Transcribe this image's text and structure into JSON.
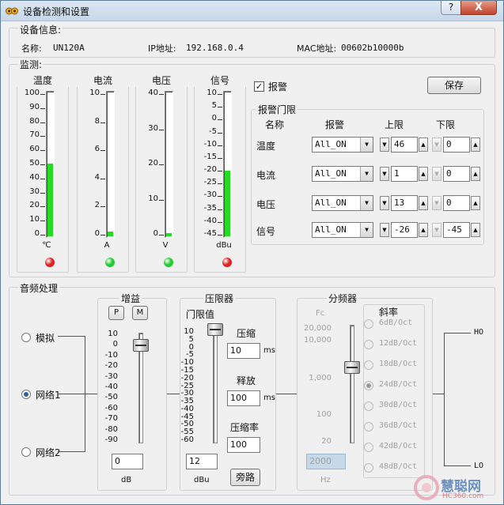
{
  "window": {
    "title": "设备检测和设置",
    "help": "?",
    "close": "X"
  },
  "device_info": {
    "header": "设备信息:",
    "name_label": "名称:",
    "name_value": "UN120A",
    "ip_label": "IP地址:",
    "ip_value": "192.168.0.4",
    "mac_label": "MAC地址:",
    "mac_value": "00602b10000b"
  },
  "monitor": {
    "header": "监测:",
    "meters": [
      {
        "title": "温度",
        "unit": "℃",
        "ticks": [
          "100",
          "90",
          "80",
          "70",
          "60",
          "50",
          "40",
          "30",
          "20",
          "10",
          "0"
        ],
        "level": 0.5,
        "led": "#e02020"
      },
      {
        "title": "电流",
        "unit": "A",
        "ticks": [
          "10",
          "8",
          "6",
          "4",
          "2",
          "0"
        ],
        "level": 0.03,
        "led": "#22cc33"
      },
      {
        "title": "电压",
        "unit": "V",
        "ticks": [
          "40",
          "30",
          "20",
          "10",
          "0"
        ],
        "level": 0.02,
        "led": "#22cc33"
      },
      {
        "title": "信号",
        "unit": "dBu",
        "ticks": [
          "10",
          "5",
          "0",
          "-5",
          "-10",
          "-15",
          "-20",
          "-25",
          "-30",
          "-35",
          "-40",
          "-45"
        ],
        "level": 0.45,
        "led": "#e02020"
      }
    ],
    "alarm_checkbox": "报警",
    "alarm_checked": "✓",
    "save_button": "保存",
    "threshold": {
      "header": "报警门限",
      "col_name": "名称",
      "col_alarm": "报警",
      "col_upper": "上限",
      "col_lower": "下限",
      "rows": [
        {
          "name": "温度",
          "alarm": "All_ON",
          "upper": "46",
          "lower": "0"
        },
        {
          "name": "电流",
          "alarm": "All_ON",
          "upper": "1",
          "lower": "0"
        },
        {
          "name": "电压",
          "alarm": "All_ON",
          "upper": "13",
          "lower": "0"
        },
        {
          "name": "信号",
          "alarm": "All_ON",
          "upper": "-26",
          "lower": "-45"
        }
      ]
    }
  },
  "audio": {
    "header": "音频处理",
    "sources": [
      {
        "label": "模拟",
        "selected": false
      },
      {
        "label": "网络1",
        "selected": true
      },
      {
        "label": "网络2",
        "selected": false
      }
    ],
    "gain": {
      "title": "增益",
      "p_button": "P",
      "m_button": "M",
      "ticks": [
        "10",
        "0",
        "-10",
        "-20",
        "-30",
        "-40",
        "-50",
        "-60",
        "-70",
        "-80",
        "-90"
      ],
      "value": "0",
      "unit": "dB",
      "slider_value_db": 0
    },
    "limiter": {
      "title": "压限器",
      "threshold_label": "门限值",
      "ticks": [
        "10",
        "5",
        "0",
        "-5",
        "-10",
        "-15",
        "-20",
        "-25",
        "-30",
        "-35",
        "-40",
        "-45",
        "-50",
        "-55",
        "-60"
      ],
      "threshold_value": "12",
      "threshold_unit": "dBu",
      "compress_label": "压缩",
      "compress_value": "10",
      "compress_unit": "ms",
      "release_label": "释放",
      "release_value": "100",
      "release_unit": "ms",
      "ratio_label": "压缩率",
      "ratio_value": "100",
      "bypass_button": "旁路"
    },
    "crossover": {
      "title": "分频器",
      "fc_label": "Fc",
      "ticks": [
        "20,000",
        "10,000",
        "1,000",
        "100",
        "20"
      ],
      "value": "2000",
      "unit": "Hz",
      "slope_title": "斜率",
      "slopes": [
        {
          "label": "6dB/Oct",
          "selected": false
        },
        {
          "label": "12dB/Oct",
          "selected": false
        },
        {
          "label": "18dB/Oct",
          "selected": false
        },
        {
          "label": "24dB/Oct",
          "selected": true
        },
        {
          "label": "30dB/Oct",
          "selected": false
        },
        {
          "label": "36dB/Oct",
          "selected": false
        },
        {
          "label": "42dB/Oct",
          "selected": false
        },
        {
          "label": "48dB/Oct",
          "selected": false
        }
      ],
      "hi_label": "HO",
      "lo_label": "LO"
    }
  },
  "watermark": {
    "brand": "慧聪网",
    "url": "HC360.com"
  }
}
